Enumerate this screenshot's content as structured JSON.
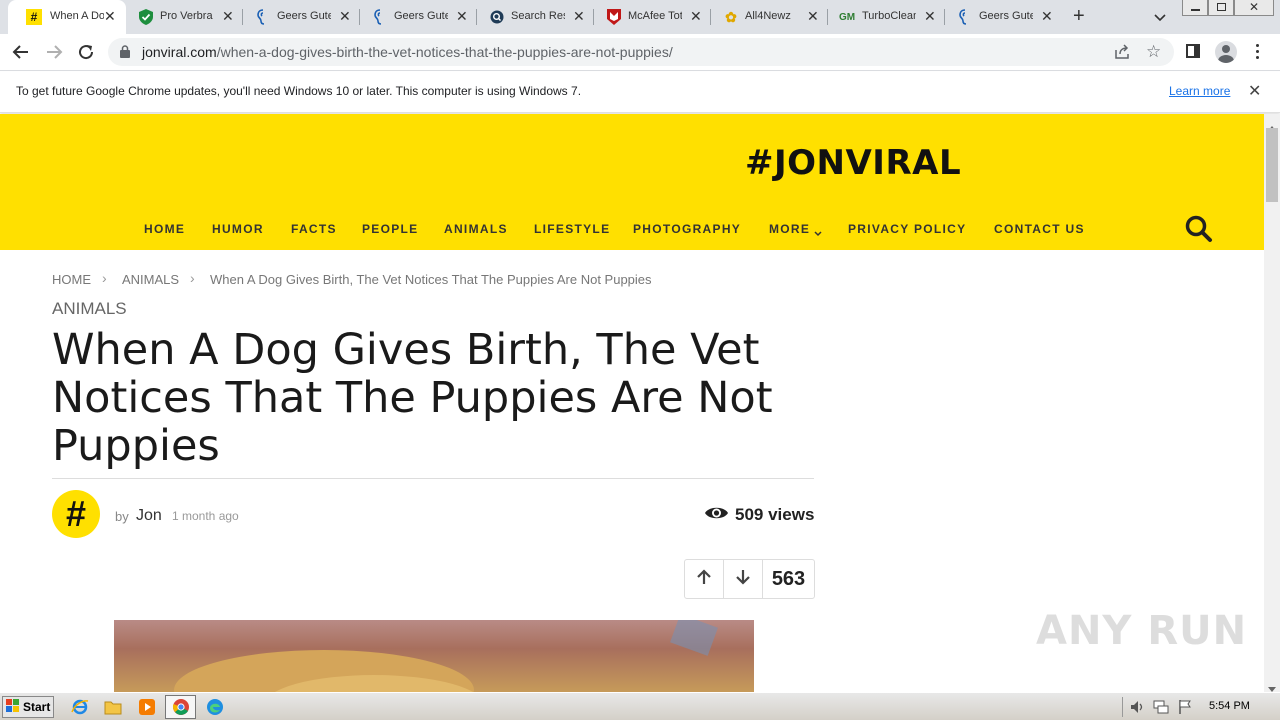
{
  "browser": {
    "tabs": [
      {
        "title": "When A Do",
        "favicon": "hashtag-icon"
      },
      {
        "title": "Pro Verbra",
        "favicon": "shield-icon"
      },
      {
        "title": "Geers Gute",
        "favicon": "ear-icon"
      },
      {
        "title": "Geers Gute",
        "favicon": "ear-icon"
      },
      {
        "title": "Search Res",
        "favicon": "search-logo-icon"
      },
      {
        "title": "McAfee Tot",
        "favicon": "mcafee-icon"
      },
      {
        "title": "All4Newz",
        "favicon": "flower-icon"
      },
      {
        "title": "TurboClean",
        "favicon": "gm-icon"
      },
      {
        "title": "Geers Gute",
        "favicon": "ear-icon"
      }
    ],
    "url_host": "jonviral.com",
    "url_path": "/when-a-dog-gives-birth-the-vet-notices-that-the-puppies-are-not-puppies/",
    "infobar_message": "To get future Google Chrome updates, you'll need Windows 10 or later. This computer is using Windows 7.",
    "infobar_link": "Learn more"
  },
  "site": {
    "logo": "#JONVIRAL",
    "brand_color": "#ffe000",
    "nav": [
      "HOME",
      "HUMOR",
      "FACTS",
      "PEOPLE",
      "ANIMALS",
      "LIFESTYLE",
      "PHOTOGRAPHY",
      "MORE",
      "PRIVACY POLICY",
      "CONTACT US"
    ]
  },
  "article": {
    "breadcrumb": [
      "HOME",
      "ANIMALS",
      "When A Dog Gives Birth, The Vet Notices That The Puppies Are Not Puppies"
    ],
    "category": "ANIMALS",
    "title": "When A Dog Gives Birth, The Vet Notices That The Puppies Are Not Puppies",
    "avatar_glyph": "#",
    "by": "by",
    "author": "Jon",
    "time_ago": "1 month ago",
    "views": "509 views",
    "vote_count": "563"
  },
  "taskbar": {
    "start": "Start",
    "clock": "5:54 PM"
  },
  "watermark": "ANY RUN"
}
